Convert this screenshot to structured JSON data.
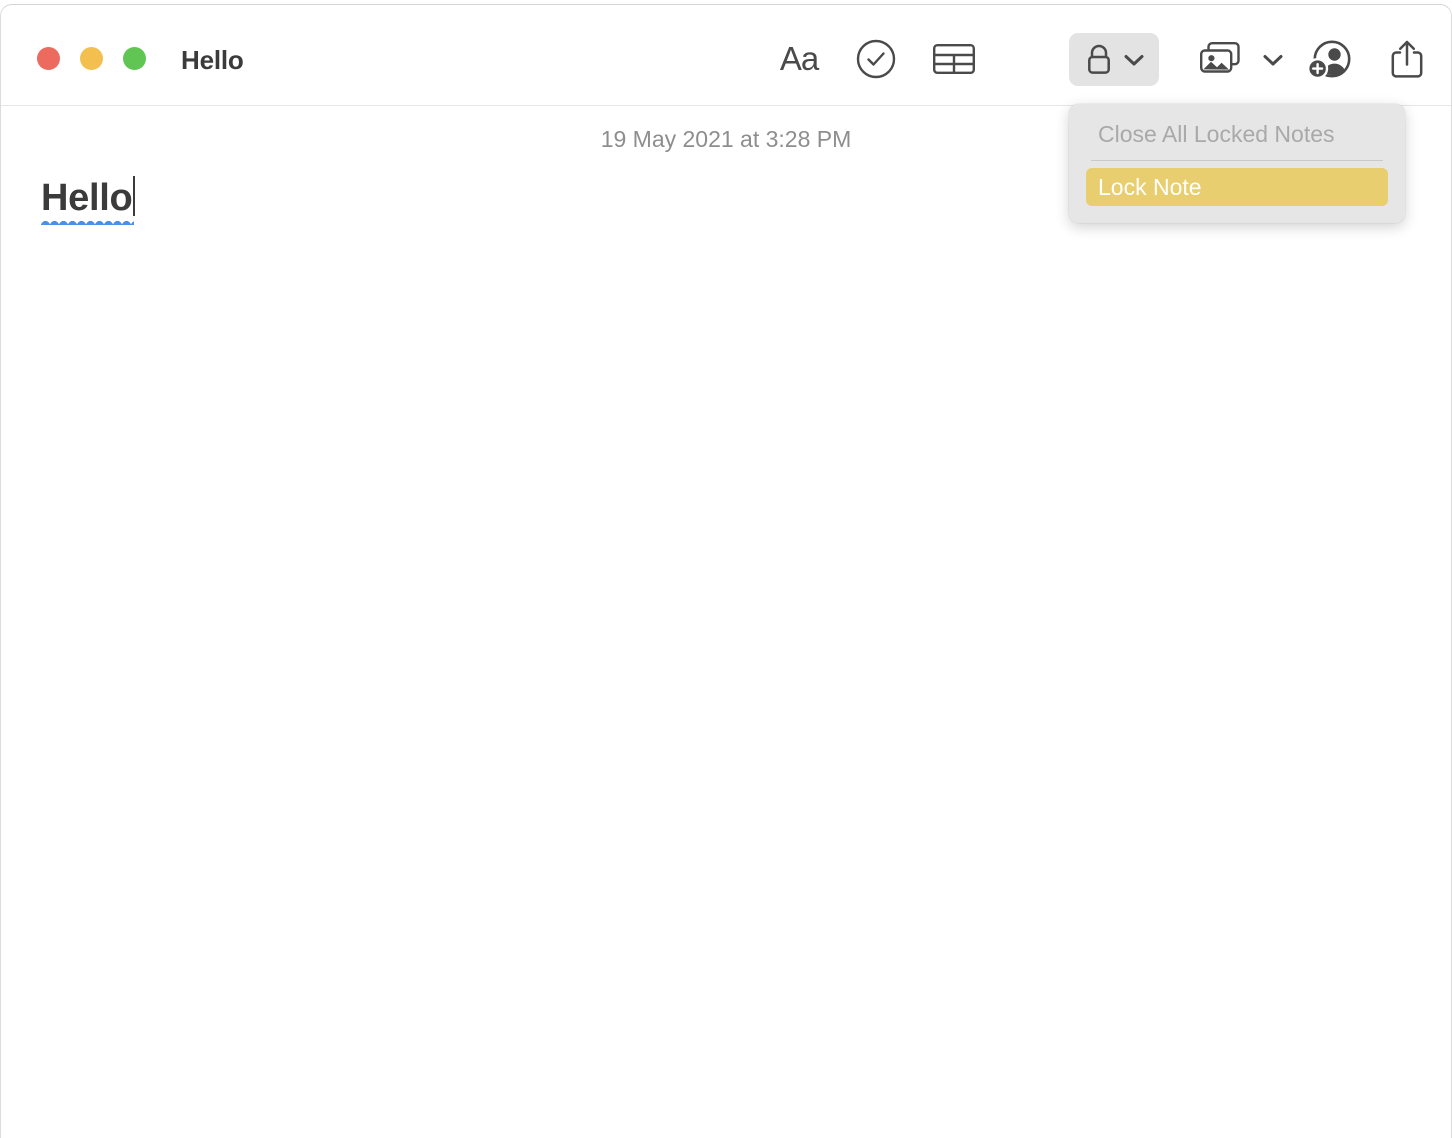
{
  "window": {
    "title": "Hello",
    "traffic_lights": [
      {
        "name": "close",
        "color": "#ec6a5e"
      },
      {
        "name": "minimize",
        "color": "#f3bf4f"
      },
      {
        "name": "maximize",
        "color": "#61c554"
      }
    ]
  },
  "toolbar": {
    "format_label": "Aa",
    "items": [
      {
        "name": "format",
        "label": "Aa"
      },
      {
        "name": "checklist",
        "label": ""
      },
      {
        "name": "table",
        "label": ""
      },
      {
        "name": "lock",
        "label": ""
      },
      {
        "name": "media",
        "label": ""
      },
      {
        "name": "collaborate",
        "label": ""
      },
      {
        "name": "share",
        "label": ""
      }
    ]
  },
  "lock_menu": {
    "open": true,
    "items": [
      {
        "label": "Close All Locked Notes",
        "state": "disabled"
      },
      {
        "label": "Lock Note",
        "state": "highlighted"
      }
    ],
    "highlight_color": "#e8ce6e",
    "background_color": "#e6e6e6"
  },
  "note": {
    "date": "19 May 2021 at 3:28 PM",
    "body": "Hello"
  }
}
